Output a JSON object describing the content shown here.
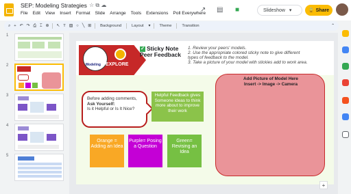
{
  "header": {
    "doc_title": "SEP: Modeling Strategies",
    "menu": [
      "File",
      "Edit",
      "View",
      "Insert",
      "Format",
      "Slide",
      "Arrange",
      "Tools",
      "Extensions",
      "Poll Everywhere"
    ],
    "slideshow_label": "Slideshow",
    "share_label": "Share"
  },
  "toolbar": {
    "background_label": "Background",
    "layout_label": "Layout",
    "theme_label": "Theme",
    "transition_label": "Transition"
  },
  "filmstrip": {
    "numbers": [
      "1",
      "2",
      "3",
      "4",
      "5"
    ],
    "selected_index": 1
  },
  "slide": {
    "badge_top_text": "Modeling",
    "explore_label": "EXPLORE",
    "sticky_title_line1": "Sticky Note",
    "sticky_title_line2": "Peer Feedback",
    "instructions": [
      "1.   Review your peers' models.",
      "2.   Use the appropriate colored sticky note to give different",
      "      types of feedback to the model.",
      "3.   Take a picture of your model with stickies add to work area."
    ],
    "speech_line1": "Before adding comments,",
    "speech_line2": "Ask Yourself:",
    "speech_line3": "Is it Helpful or Is It Nice?",
    "helpful_text": "Helpful Feedback gives Someone ideas to think more about to improve their work",
    "note_orange": "Orange = Adding an Idea",
    "note_purple": "Purple= Posing a Question",
    "note_green": "Green= Revising an Idea",
    "model_line1": "Add Picture of Model Here",
    "model_line2": "Insert -> Image -> Camera"
  },
  "colors": {
    "brand_yellow": "#fbbc04",
    "explore_red": "#c62828",
    "note_orange": "#f9a825",
    "note_purple": "#c400d6",
    "note_green": "#76c043",
    "model_pink": "#ea9499"
  }
}
